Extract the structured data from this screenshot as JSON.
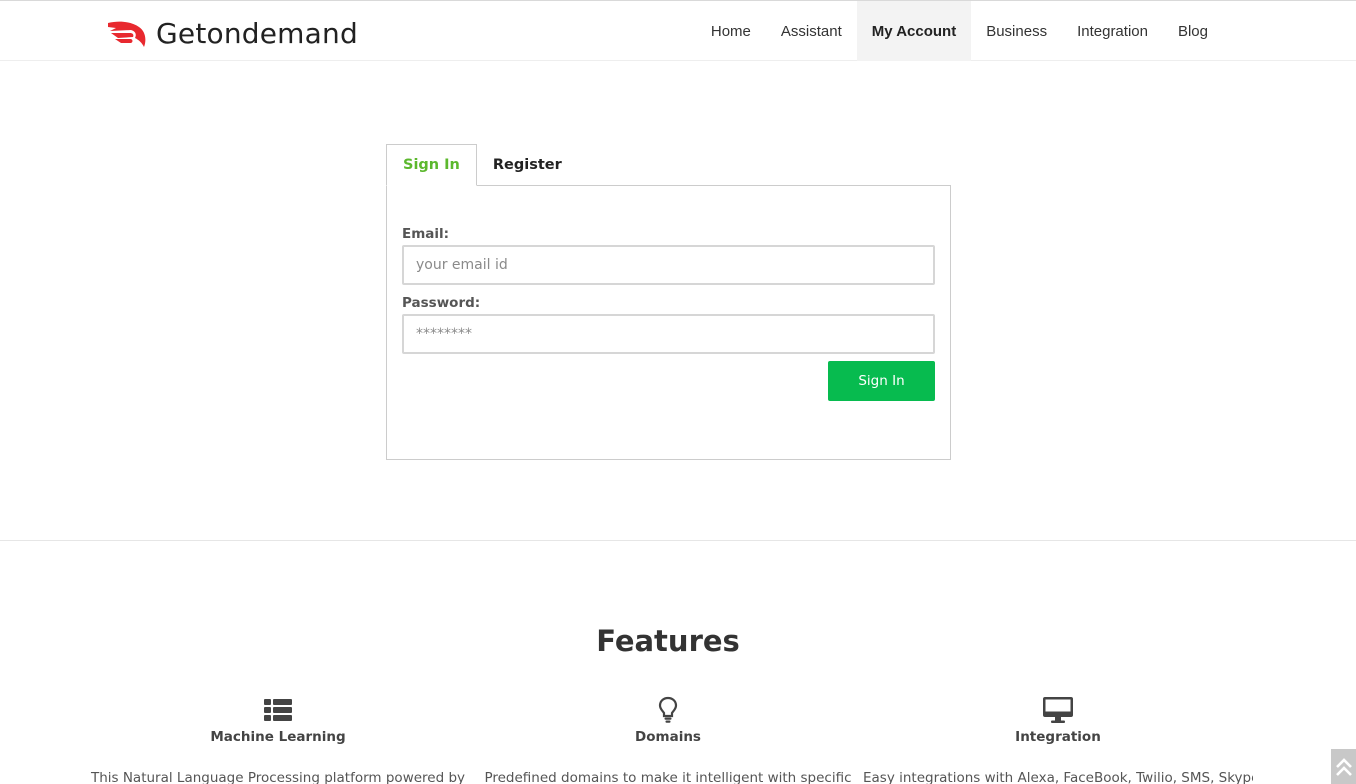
{
  "header": {
    "brand_name": "Getondemand",
    "nav": [
      {
        "label": "Home"
      },
      {
        "label": "Assistant"
      },
      {
        "label": "My Account",
        "active": true
      },
      {
        "label": "Business"
      },
      {
        "label": "Integration"
      },
      {
        "label": "Blog"
      }
    ]
  },
  "auth": {
    "tabs": [
      {
        "label": "Sign In",
        "active": true
      },
      {
        "label": "Register"
      }
    ],
    "email_label": "Email:",
    "email_placeholder": "your email id",
    "password_label": "Password:",
    "password_placeholder": "********",
    "submit_label": "Sign In"
  },
  "features": {
    "title": "Features",
    "items": [
      {
        "title": "Machine Learning",
        "icon": "list-icon",
        "description": "This Natural Language Processing platform powered by"
      },
      {
        "title": "Domains",
        "icon": "lightbulb-icon",
        "description": "Predefined domains to make it intelligent with specific"
      },
      {
        "title": "Integration",
        "icon": "desktop-icon",
        "description": "Easy integrations with Alexa, FaceBook, Twilio, SMS, Skype"
      }
    ]
  },
  "colors": {
    "accent_green": "#07bb4f",
    "tab_active_text": "#5cb82e",
    "logo_red": "#e8292f"
  }
}
